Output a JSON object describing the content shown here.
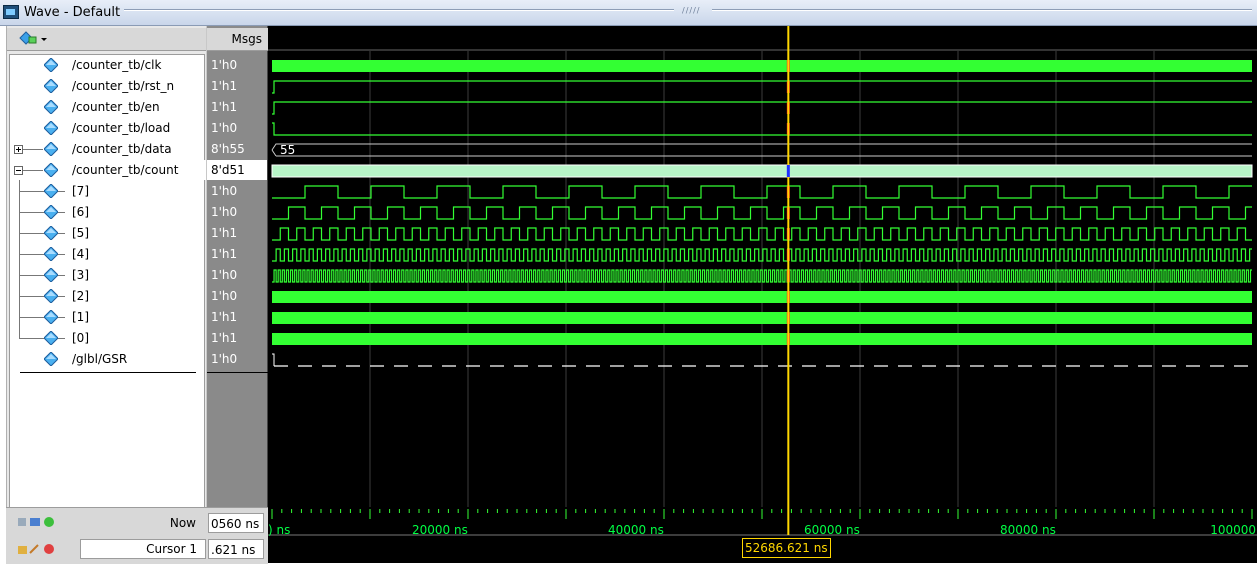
{
  "window": {
    "title": "Wave - Default"
  },
  "headers": {
    "msgs": "Msgs"
  },
  "signals": [
    {
      "name": "/counter_tb/clk",
      "value": "1'h0",
      "expander": "none",
      "level": 0
    },
    {
      "name": "/counter_tb/rst_n",
      "value": "1'h1",
      "expander": "none",
      "level": 0
    },
    {
      "name": "/counter_tb/en",
      "value": "1'h1",
      "expander": "none",
      "level": 0
    },
    {
      "name": "/counter_tb/load",
      "value": "1'h0",
      "expander": "none",
      "level": 0
    },
    {
      "name": "/counter_tb/data",
      "value": "8'h55",
      "expander": "plus",
      "level": 0
    },
    {
      "name": "/counter_tb/count",
      "value": "8'd51",
      "expander": "minus",
      "level": 0,
      "selected": true
    },
    {
      "name": "[7]",
      "value": "1'h0",
      "expander": "none",
      "level": 1
    },
    {
      "name": "[6]",
      "value": "1'h0",
      "expander": "none",
      "level": 1
    },
    {
      "name": "[5]",
      "value": "1'h1",
      "expander": "none",
      "level": 1
    },
    {
      "name": "[4]",
      "value": "1'h1",
      "expander": "none",
      "level": 1
    },
    {
      "name": "[3]",
      "value": "1'h0",
      "expander": "none",
      "level": 1
    },
    {
      "name": "[2]",
      "value": "1'h0",
      "expander": "none",
      "level": 1
    },
    {
      "name": "[1]",
      "value": "1'h1",
      "expander": "none",
      "level": 1
    },
    {
      "name": "[0]",
      "value": "1'h1",
      "expander": "none",
      "level": 1
    },
    {
      "name": "/glbl/GSR",
      "value": "1'h0",
      "expander": "none",
      "level": 0
    }
  ],
  "bus_label": "55",
  "status": {
    "now_label": "Now",
    "now_value": "0560 ns",
    "cursor_label": "Cursor 1",
    "cursor_value": ".621 ns"
  },
  "timeline": {
    "range_ns": [
      0,
      100000
    ],
    "tick_labels": [
      {
        "t": 0,
        "text": ") ns"
      },
      {
        "t": 20000,
        "text": "20000 ns"
      },
      {
        "t": 40000,
        "text": "40000 ns"
      },
      {
        "t": 60000,
        "text": "60000 ns"
      },
      {
        "t": 80000,
        "text": "80000 ns"
      },
      {
        "t": 100000,
        "text": "100000"
      }
    ],
    "cursor_time_ns": 52686.621,
    "cursor_readout": "52686.621 ns"
  },
  "colors": {
    "wave": "#33ff33",
    "bus_fill": "#b8f5c8",
    "cursor": "#ffd700",
    "grid": "#3c3c3c",
    "gsr": "#ffffff"
  }
}
